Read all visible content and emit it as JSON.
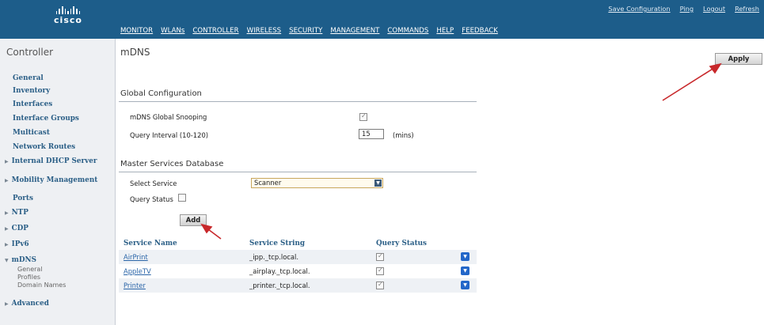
{
  "brand": {
    "logo_text": "cisco"
  },
  "nav": {
    "items": [
      "MONITOR",
      "WLANs",
      "CONTROLLER",
      "WIRELESS",
      "SECURITY",
      "MANAGEMENT",
      "COMMANDS",
      "HELP",
      "FEEDBACK"
    ]
  },
  "util": {
    "items": [
      "Save Configuration",
      "Ping",
      "Logout",
      "Refresh"
    ]
  },
  "sidebar": {
    "title": "Controller",
    "items": [
      "General",
      "Inventory",
      "Interfaces",
      "Interface Groups",
      "Multicast",
      "Network Routes",
      "Internal DHCP Server",
      "Mobility Management",
      "Ports",
      "NTP",
      "CDP",
      "IPv6",
      "mDNS",
      "Advanced"
    ],
    "mdns_sub": [
      "General",
      "Profiles",
      "Domain Names"
    ]
  },
  "page": {
    "title": "mDNS",
    "apply_label": "Apply"
  },
  "global": {
    "heading": "Global Configuration",
    "snooping_label": "mDNS Global Snooping",
    "snooping_checked": true,
    "interval_label": "Query Interval (10-120)",
    "interval_value": "15",
    "interval_unit": "(mins)"
  },
  "master": {
    "heading": "Master Services Database",
    "select_label": "Select Service",
    "select_value": "Scanner",
    "query_status_label": "Query Status",
    "query_status_checked": false,
    "add_label": "Add"
  },
  "table": {
    "headers": [
      "Service Name",
      "Service String",
      "Query Status"
    ],
    "rows": [
      {
        "name": "AirPrint",
        "string": "_ipp._tcp.local.",
        "query": true
      },
      {
        "name": "AppleTV",
        "string": "_airplay._tcp.local.",
        "query": true
      },
      {
        "name": "Printer",
        "string": "_printer._tcp.local.",
        "query": true
      }
    ]
  },
  "colors": {
    "header_bg": "#1d5d8a",
    "link": "#2a5e86",
    "arrow": "#c8282b",
    "row_button": "#2367c9"
  }
}
